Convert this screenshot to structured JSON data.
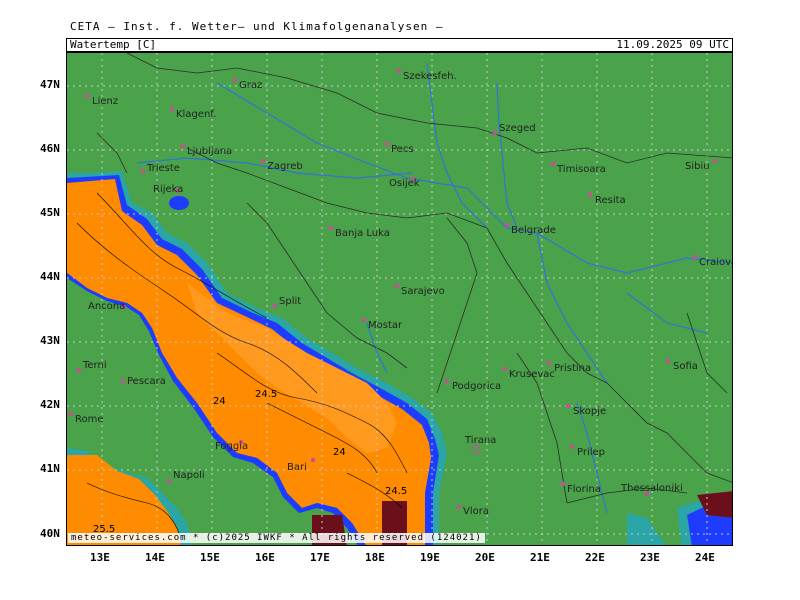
{
  "header": {
    "title": "CETA — Inst. f. Wetter— und Klimafolgenanalysen —",
    "parameter": "Watertemp [C]",
    "datetime": "11.09.2025 09 UTC"
  },
  "map": {
    "lat_labels": [
      "47N",
      "46N",
      "45N",
      "44N",
      "43N",
      "42N",
      "41N",
      "40N"
    ],
    "lon_labels": [
      "13E",
      "14E",
      "15E",
      "16E",
      "17E",
      "18E",
      "19E",
      "20E",
      "21E",
      "22E",
      "23E",
      "24E"
    ],
    "cities": [
      "Lienz",
      "Graz",
      "Szekesfeh.",
      "Klagenf.",
      "Szeged",
      "Ljubljana",
      "Pecs",
      "Zagreb",
      "Timisoara",
      "Sibiu",
      "Trieste",
      "Osijek",
      "Rijeka",
      "Resita",
      "Banja Luka",
      "Belgrade",
      "Craiova",
      "Sarajevo",
      "Ancona",
      "Split",
      "Mostar",
      "Terni",
      "Pristina",
      "Sofia",
      "Krusevac",
      "Podgorica",
      "Pescara",
      "Skopje",
      "Rome",
      "Tirana",
      "Prilep",
      "Foggia",
      "Bari",
      "Napoli",
      "Florina",
      "Thessaloniki",
      "Vlora"
    ],
    "contour_labels": [
      "24.5",
      "24",
      "24",
      "24.5",
      "25.5"
    ],
    "colors": {
      "land": "#4aa34a",
      "sea_warm": "#ff8c00",
      "sea_warmer": "#ff9a1f",
      "coast_cool": "#1e3cff",
      "coast_mid": "#2aa6a6",
      "hot_spot": "#6b0f1a",
      "rivers": "#2f74d8",
      "borders": "#2b2b2b",
      "grid": "#cccccc",
      "city_marker": "#d04a9a"
    }
  },
  "footer": {
    "copyright": "meteo-services.com * (c)2025 IWKF * All rights reserved (124021)"
  }
}
